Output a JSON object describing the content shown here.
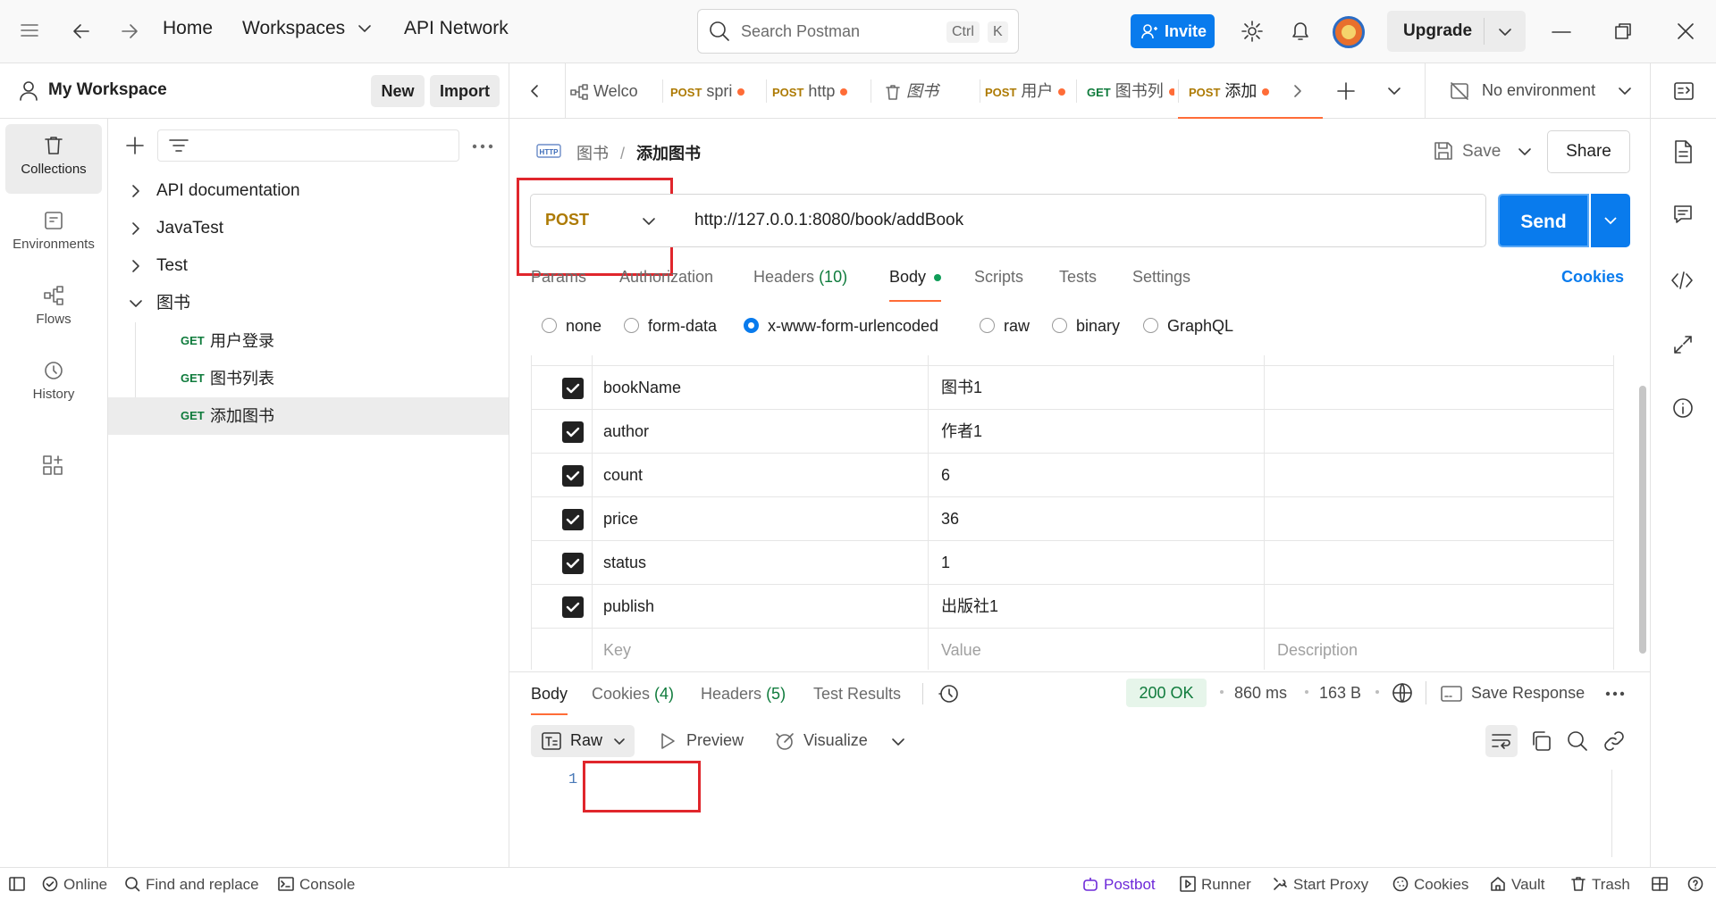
{
  "topbar": {
    "nav": [
      "Home",
      "Workspaces",
      "API Network"
    ],
    "search_placeholder": "Search Postman",
    "shortcut_ctrl": "Ctrl",
    "shortcut_k": "K",
    "invite_label": "Invite",
    "upgrade_label": "Upgrade"
  },
  "workspace": {
    "name": "My Workspace",
    "new_label": "New",
    "import_label": "Import"
  },
  "rail": [
    {
      "label": "Collections",
      "icon": "trash-can-icon"
    },
    {
      "label": "Environments",
      "icon": "environment-icon"
    },
    {
      "label": "Flows",
      "icon": "flows-icon"
    },
    {
      "label": "History",
      "icon": "history-icon"
    }
  ],
  "collections": [
    {
      "label": "API documentation"
    },
    {
      "label": "JavaTest"
    },
    {
      "label": "Test"
    },
    {
      "label": "图书",
      "expanded": true
    }
  ],
  "requests": [
    {
      "method": "GET",
      "label": "用户登录"
    },
    {
      "method": "GET",
      "label": "图书列表"
    },
    {
      "method": "GET",
      "label": "添加图书",
      "selected": true
    }
  ],
  "tabs": [
    {
      "method": "",
      "label": "Welco"
    },
    {
      "method": "POST",
      "label": "spri"
    },
    {
      "method": "POST",
      "label": "http"
    },
    {
      "method": "",
      "label": "图书"
    },
    {
      "method": "POST",
      "label": "用户"
    },
    {
      "method": "GET",
      "label": "图书列"
    },
    {
      "method": "POST",
      "label": "添加",
      "active": true
    }
  ],
  "environment": "No environment",
  "breadcrumb": {
    "parent": "图书",
    "separator": "/",
    "current": "添加图书"
  },
  "actions": {
    "save": "Save",
    "share": "Share"
  },
  "request": {
    "method": "POST",
    "url": "http://127.0.0.1:8080/book/addBook",
    "send_label": "Send"
  },
  "request_tabs": {
    "params": "Params",
    "authorization": "Authorization",
    "headers": "Headers",
    "headers_count": "(10)",
    "body": "Body",
    "scripts": "Scripts",
    "tests": "Tests",
    "settings": "Settings",
    "cookies": "Cookies"
  },
  "body_types": [
    "none",
    "form-data",
    "x-www-form-urlencoded",
    "raw",
    "binary",
    "GraphQL"
  ],
  "body_type_selected": "x-www-form-urlencoded",
  "form_rows": [
    {
      "key": "bookName",
      "value": "图书1",
      "checked": true
    },
    {
      "key": "author",
      "value": "作者1",
      "checked": true
    },
    {
      "key": "count",
      "value": "6",
      "checked": true
    },
    {
      "key": "price",
      "value": "36",
      "checked": true
    },
    {
      "key": "status",
      "value": "1",
      "checked": true
    },
    {
      "key": "publish",
      "value": "出版社1",
      "checked": true
    }
  ],
  "form_placeholders": {
    "key": "Key",
    "value": "Value",
    "description": "Description"
  },
  "response": {
    "tabs": {
      "body": "Body",
      "cookies": "Cookies",
      "cookies_count": "(4)",
      "headers": "Headers",
      "headers_count": "(5)",
      "test_results": "Test Results"
    },
    "status": "200 OK",
    "time": "860 ms",
    "size": "163 B",
    "save_response": "Save Response",
    "view_raw": "Raw",
    "view_preview": "Preview",
    "view_visualize": "Visualize",
    "line_number": "1"
  },
  "statusbar": {
    "online": "Online",
    "find_replace": "Find and replace",
    "console": "Console",
    "postbot": "Postbot",
    "runner": "Runner",
    "start_proxy": "Start Proxy",
    "cookies": "Cookies",
    "vault": "Vault",
    "trash": "Trash"
  },
  "colors": {
    "accent": "#097bed",
    "post": "#ad7a03",
    "get": "#0f7b3c",
    "tab_dot": "#ff6c37",
    "highlight": "#e0262c"
  }
}
